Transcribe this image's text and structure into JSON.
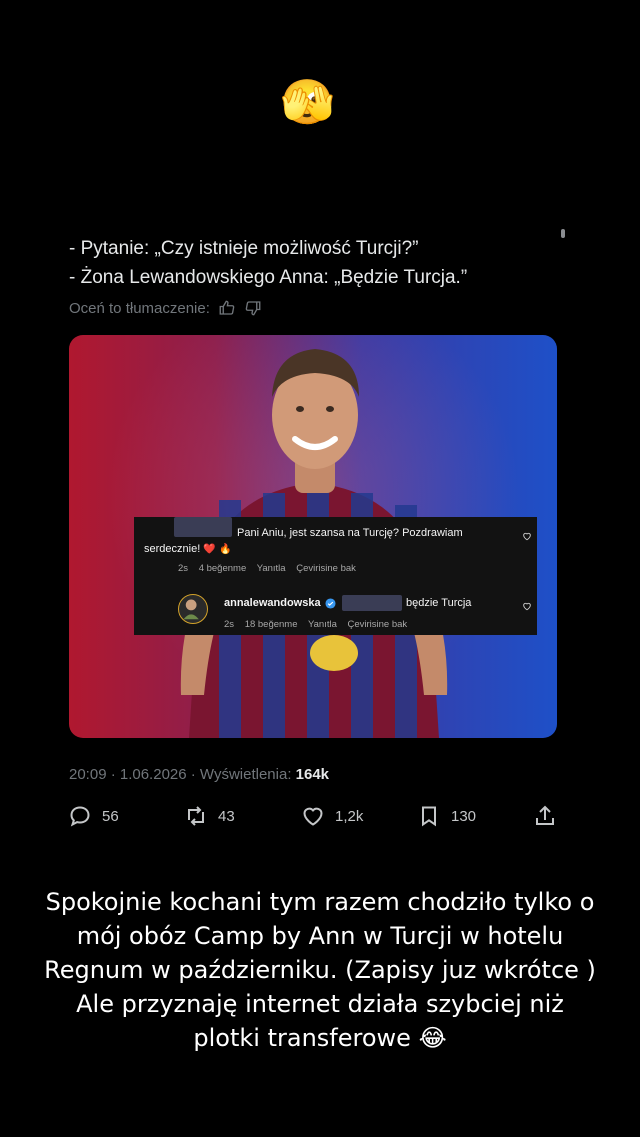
{
  "top_emoji": "🫣",
  "tweet": {
    "line1": "- Pytanie: „Czy istnieje możliwość Turcji?”",
    "line2": "- Żona Lewandowskiego Anna: „Będzie Turcja.”",
    "translation_prompt": "Oceń to tłumaczenie:",
    "timestamp": "20:09 · 1.06.2026 · Wyświetlenia: ",
    "views": "164k"
  },
  "comment_overlay": {
    "comment1_line1": "Pani Aniu, jest szansa na Turcję? Pozdrawiam",
    "comment1_line2": "serdecznie!",
    "comment1_emojis": "❤️ 🔥",
    "comment1_age": "2s",
    "comment1_likes": "4 beğenme",
    "reply_label": "Yanıtla",
    "translate_label": "Çevirisine bak",
    "comment2_user": "annalewandowska",
    "comment2_text": "będzie Turcja",
    "comment2_age": "2s",
    "comment2_likes": "18 beğenme"
  },
  "actions": {
    "replies": "56",
    "reposts": "43",
    "likes": "1,2k",
    "bookmarks": "130"
  },
  "caption": {
    "line1": "Spokojnie kochani tym razem chodziło tylko o",
    "line2": "mój obóz Camp by Ann w Turcji w hotelu",
    "line3": "Regnum w październiku. (Zapisy juz wkrótce )",
    "line4": "Ale przyznaję internet działa szybciej niż",
    "line5": "plotki transferowe",
    "emoji": "😂"
  },
  "colors": {
    "background": "#000000",
    "text": "#e7e9ea",
    "muted": "#71767b",
    "media_left": "#b0182f",
    "media_right": "#1e50c8"
  }
}
